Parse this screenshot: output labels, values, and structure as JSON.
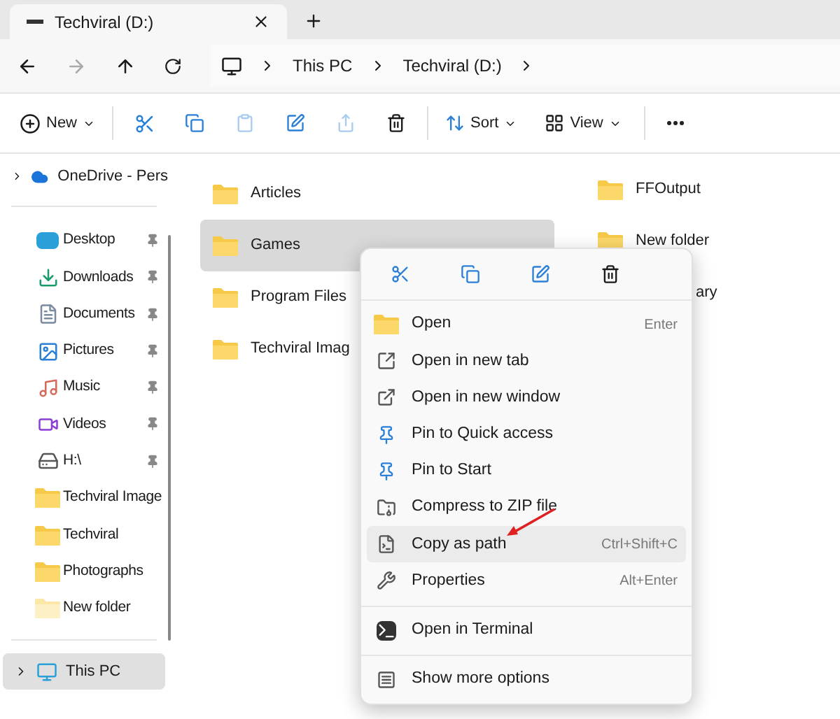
{
  "tabs": [
    {
      "title": "Techviral (D:)",
      "selected": true
    }
  ],
  "address": {
    "crumbs": [
      "This PC",
      "Techviral (D:)"
    ]
  },
  "toolbar": {
    "new_label": "New",
    "sort_label": "Sort",
    "view_label": "View"
  },
  "sidebar": {
    "top": {
      "label": "OneDrive - Pers",
      "expanded": false
    },
    "quick": [
      {
        "label": "Desktop",
        "pinned": true
      },
      {
        "label": "Downloads",
        "pinned": true
      },
      {
        "label": "Documents",
        "pinned": true
      },
      {
        "label": "Pictures",
        "pinned": true
      },
      {
        "label": "Music",
        "pinned": true
      },
      {
        "label": "Videos",
        "pinned": true
      },
      {
        "label": "H:\\",
        "pinned": true
      },
      {
        "label": "Techviral Image",
        "pinned": false
      },
      {
        "label": "Techviral",
        "pinned": false
      },
      {
        "label": "Photographs",
        "pinned": false
      },
      {
        "label": "New folder",
        "pinned": false
      }
    ],
    "this_pc": {
      "label": "This PC",
      "selected": true,
      "expanded": false
    }
  },
  "folders_left": [
    {
      "label": "Articles",
      "selected": false
    },
    {
      "label": "Games",
      "selected": true
    },
    {
      "label": "Program Files",
      "selected": false
    },
    {
      "label": "Techviral Imag",
      "selected": false
    }
  ],
  "folders_right": [
    {
      "label": "FFOutput"
    },
    {
      "label": "New folder"
    },
    {
      "label": "ary"
    }
  ],
  "context_menu": {
    "sections": [
      [
        {
          "label": "Open",
          "shortcut": "Enter",
          "highlighted": false
        },
        {
          "label": "Open in new tab",
          "highlighted": false
        },
        {
          "label": "Open in new window",
          "highlighted": false
        },
        {
          "label": "Pin to Quick access",
          "highlighted": false
        },
        {
          "label": "Pin to Start",
          "highlighted": false
        },
        {
          "label": "Compress to ZIP file",
          "highlighted": false
        },
        {
          "label": "Copy as path",
          "shortcut": "Ctrl+Shift+C",
          "highlighted": true
        },
        {
          "label": "Properties",
          "shortcut": "Alt+Enter",
          "highlighted": false
        }
      ],
      [
        {
          "label": "Open in Terminal",
          "highlighted": false
        }
      ],
      [
        {
          "label": "Show more options",
          "highlighted": false
        }
      ]
    ]
  }
}
